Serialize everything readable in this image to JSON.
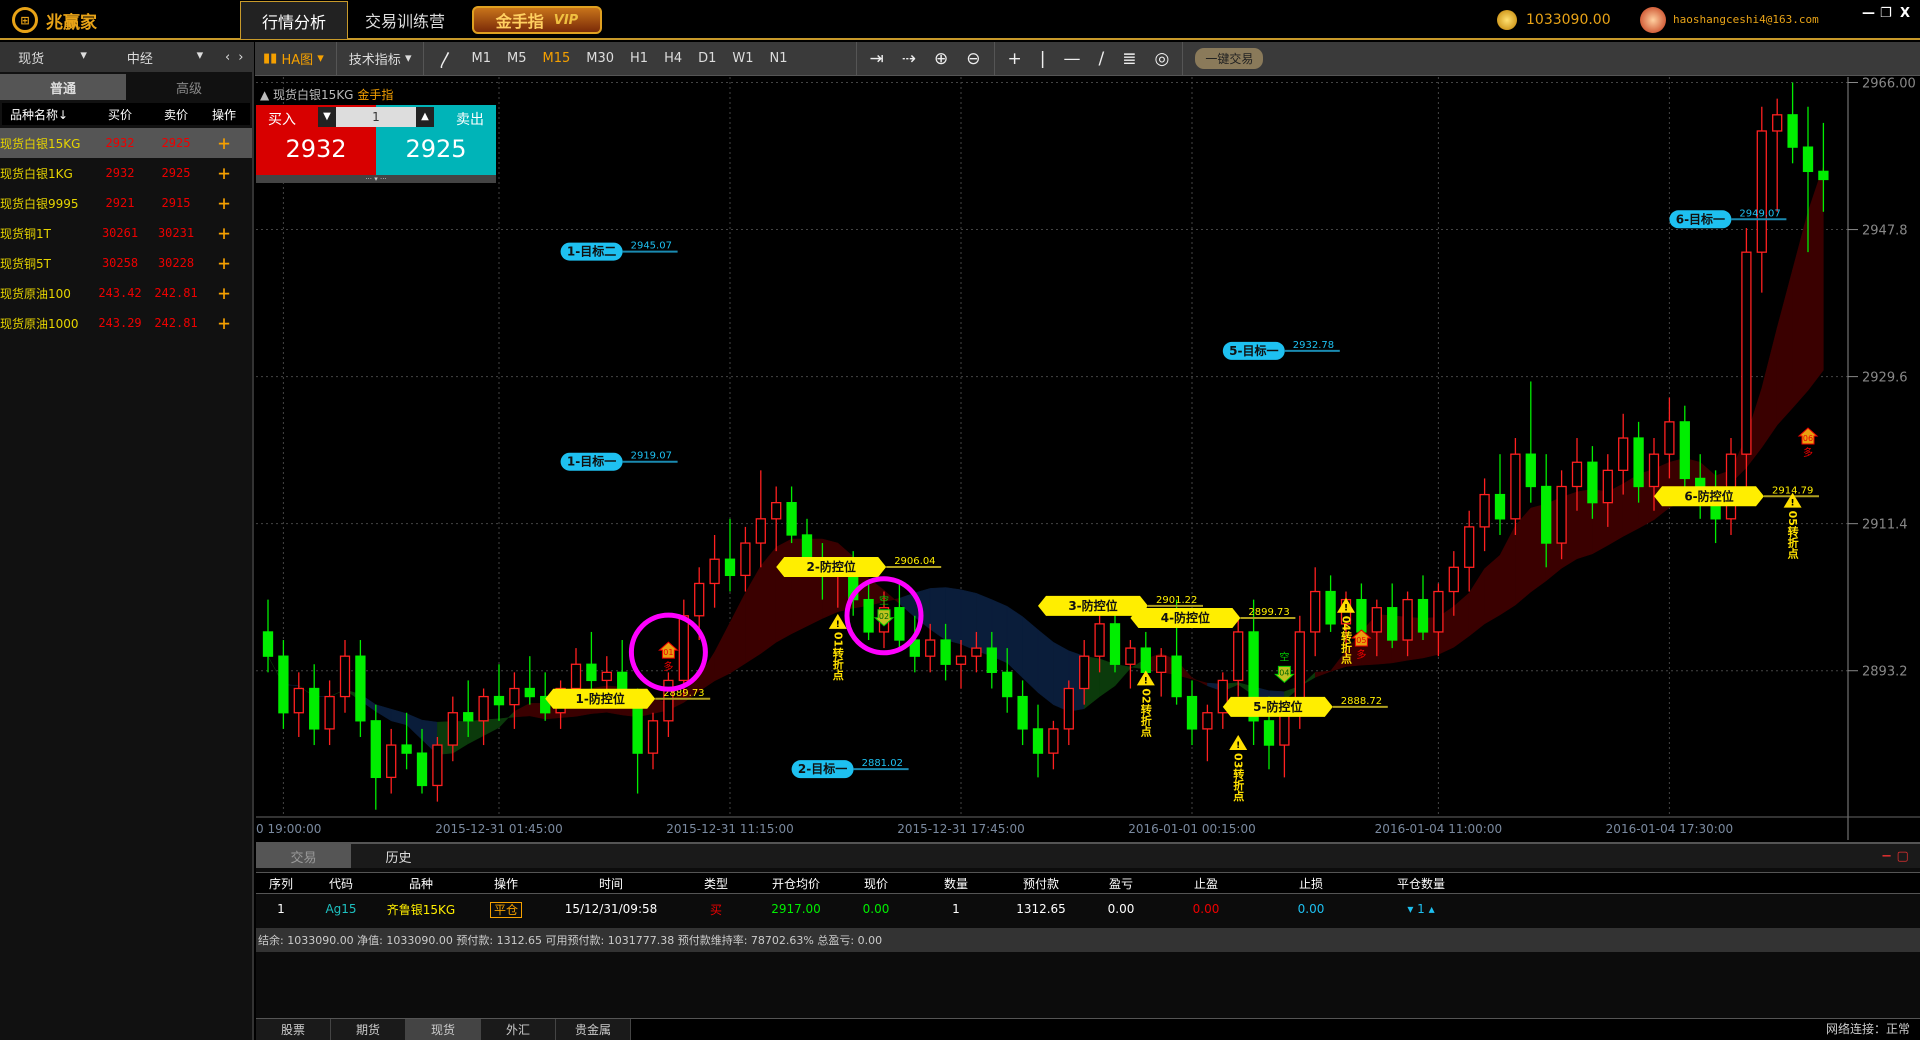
{
  "app": {
    "logo": "兆赢家",
    "tabs": [
      "行情分析",
      "交易训练营"
    ],
    "vip_badge": "金手指",
    "vip_tag": "VIP",
    "balance": "1033090.00",
    "email": "haoshangceshi4@163.com",
    "window_controls": [
      "—",
      "❐",
      "X"
    ]
  },
  "toolbar": {
    "chart_type": "HA图",
    "indicators": "技术指标",
    "periods": [
      "M1",
      "M5",
      "M15",
      "M30",
      "H1",
      "H4",
      "D1",
      "W1",
      "N1"
    ],
    "active_period": "M15",
    "icons": [
      "line-icon",
      "fit-right-icon",
      "move-right-icon",
      "zoom-in-icon",
      "zoom-out-icon",
      "crosshair-icon",
      "vertical-line-icon",
      "horizontal-line-icon",
      "trend-line-icon",
      "fibonacci-icon",
      "ellipse-icon"
    ],
    "one_click": "一键交易"
  },
  "sidebar": {
    "market": "现货",
    "exchange": "中经",
    "subtabs": [
      "普通",
      "高级"
    ],
    "headers": [
      "品种名称↓",
      "买价",
      "卖价",
      "操作"
    ],
    "rows": [
      {
        "name": "现货白银15KG",
        "buy": "2932",
        "sell": "2925"
      },
      {
        "name": "现货白银1KG",
        "buy": "2932",
        "sell": "2925"
      },
      {
        "name": "现货白银9995",
        "buy": "2921",
        "sell": "2915"
      },
      {
        "name": "现货铜1T",
        "buy": "30261",
        "sell": "30231"
      },
      {
        "name": "现货铜5T",
        "buy": "30258",
        "sell": "30228"
      },
      {
        "name": "现货原油100",
        "buy": "243.42",
        "sell": "242.81"
      },
      {
        "name": "现货原油1000",
        "buy": "243.29",
        "sell": "242.81"
      }
    ]
  },
  "order_panel": {
    "symbol": "现货白银15KG",
    "tag": "金手指",
    "buy_label": "买入",
    "sell_label": "卖出",
    "quantity": "1",
    "buy_price": "2932",
    "sell_price": "2925"
  },
  "colors": {
    "up": "#ff2020",
    "down": "#00ee00",
    "accent": "#f5a000",
    "target": "#1ec0f0",
    "defense": "#ffee00",
    "highlight": "#ff00ff"
  },
  "chart_data": {
    "type": "candlestick",
    "ylim": [
      2875,
      2966
    ],
    "y_ticks": [
      "2966.00",
      "2947.8",
      "2929.6",
      "2911.4",
      "2893.2"
    ],
    "y_tick_values": [
      2966,
      2947.8,
      2929.6,
      2911.4,
      2893.2
    ],
    "x_ticks": [
      "0 19:00:00",
      "2015-12-31 01:45:00",
      "2015-12-31 11:15:00",
      "2015-12-31 17:45:00",
      "2016-01-01 00:15:00",
      "2016-01-04 11:00:00",
      "2016-01-04 17:30:00"
    ],
    "x_tick_index": [
      1,
      15,
      30,
      45,
      60,
      76,
      91
    ],
    "ohlc": [
      [
        2898,
        2902,
        2893,
        2895
      ],
      [
        2895,
        2897,
        2886,
        2888
      ],
      [
        2888,
        2893,
        2885,
        2891
      ],
      [
        2891,
        2894,
        2884,
        2886
      ],
      [
        2886,
        2892,
        2884,
        2890
      ],
      [
        2890,
        2897,
        2888,
        2895
      ],
      [
        2895,
        2897,
        2885,
        2887
      ],
      [
        2887,
        2889,
        2876,
        2880
      ],
      [
        2880,
        2886,
        2878,
        2884
      ],
      [
        2884,
        2888,
        2881,
        2883
      ],
      [
        2883,
        2886,
        2878,
        2879
      ],
      [
        2879,
        2885,
        2877,
        2884
      ],
      [
        2884,
        2890,
        2882,
        2888
      ],
      [
        2888,
        2892,
        2885,
        2887
      ],
      [
        2887,
        2891,
        2884,
        2890
      ],
      [
        2890,
        2894,
        2887,
        2889
      ],
      [
        2889,
        2893,
        2886,
        2891
      ],
      [
        2891,
        2895,
        2889,
        2890
      ],
      [
        2890,
        2893,
        2887,
        2888
      ],
      [
        2888,
        2892,
        2886,
        2891
      ],
      [
        2891,
        2896,
        2889,
        2894
      ],
      [
        2894,
        2898,
        2890,
        2892
      ],
      [
        2892,
        2895,
        2889,
        2893
      ],
      [
        2893,
        2897,
        2890,
        2889
      ],
      [
        2889,
        2891,
        2878,
        2883
      ],
      [
        2883,
        2888,
        2881,
        2887
      ],
      [
        2887,
        2893,
        2885,
        2892
      ],
      [
        2892,
        2902,
        2890,
        2900
      ],
      [
        2900,
        2906,
        2897,
        2904
      ],
      [
        2904,
        2910,
        2901,
        2907
      ],
      [
        2907,
        2912,
        2903,
        2905
      ],
      [
        2905,
        2911,
        2903,
        2909
      ],
      [
        2909,
        2918,
        2906,
        2912
      ],
      [
        2912,
        2916,
        2908,
        2914
      ],
      [
        2914,
        2916,
        2909,
        2910
      ],
      [
        2910,
        2912,
        2905,
        2907
      ],
      [
        2907,
        2909,
        2902,
        2905
      ],
      [
        2905,
        2907,
        2901,
        2906
      ],
      [
        2906,
        2908,
        2900,
        2902
      ],
      [
        2902,
        2904,
        2897,
        2898
      ],
      [
        2898,
        2903,
        2896,
        2901
      ],
      [
        2901,
        2904,
        2896,
        2897
      ],
      [
        2897,
        2900,
        2893,
        2895
      ],
      [
        2895,
        2899,
        2893,
        2897
      ],
      [
        2897,
        2899,
        2892,
        2894
      ],
      [
        2894,
        2897,
        2891,
        2895
      ],
      [
        2895,
        2898,
        2893,
        2896
      ],
      [
        2896,
        2898,
        2891,
        2893
      ],
      [
        2893,
        2896,
        2888,
        2890
      ],
      [
        2890,
        2892,
        2884,
        2886
      ],
      [
        2886,
        2889,
        2880,
        2883
      ],
      [
        2883,
        2887,
        2881,
        2886
      ],
      [
        2886,
        2892,
        2884,
        2891
      ],
      [
        2891,
        2897,
        2889,
        2895
      ],
      [
        2895,
        2901,
        2893,
        2899
      ],
      [
        2899,
        2901,
        2893,
        2894
      ],
      [
        2894,
        2897,
        2891,
        2896
      ],
      [
        2896,
        2898,
        2892,
        2893
      ],
      [
        2893,
        2896,
        2890,
        2895
      ],
      [
        2895,
        2902,
        2889,
        2890
      ],
      [
        2890,
        2892,
        2884,
        2886
      ],
      [
        2886,
        2889,
        2882,
        2888
      ],
      [
        2888,
        2893,
        2886,
        2892
      ],
      [
        2892,
        2900,
        2890,
        2898
      ],
      [
        2898,
        2902,
        2884,
        2887
      ],
      [
        2887,
        2890,
        2881,
        2884
      ],
      [
        2884,
        2889,
        2880,
        2888
      ],
      [
        2888,
        2900,
        2886,
        2898
      ],
      [
        2898,
        2906,
        2895,
        2903
      ],
      [
        2903,
        2905,
        2898,
        2899
      ],
      [
        2899,
        2903,
        2895,
        2902
      ],
      [
        2902,
        2904,
        2897,
        2898
      ],
      [
        2898,
        2902,
        2895,
        2901
      ],
      [
        2901,
        2904,
        2896,
        2897
      ],
      [
        2897,
        2903,
        2895,
        2902
      ],
      [
        2902,
        2905,
        2897,
        2898
      ],
      [
        2898,
        2904,
        2895,
        2903
      ],
      [
        2903,
        2908,
        2900,
        2906
      ],
      [
        2906,
        2913,
        2903,
        2911
      ],
      [
        2911,
        2917,
        2908,
        2915
      ],
      [
        2915,
        2920,
        2910,
        2912
      ],
      [
        2912,
        2922,
        2910,
        2920
      ],
      [
        2920,
        2929,
        2914,
        2916
      ],
      [
        2916,
        2920,
        2906,
        2909
      ],
      [
        2909,
        2918,
        2907,
        2916
      ],
      [
        2916,
        2922,
        2913,
        2919
      ],
      [
        2919,
        2921,
        2912,
        2914
      ],
      [
        2914,
        2920,
        2911,
        2918
      ],
      [
        2918,
        2925,
        2915,
        2922
      ],
      [
        2922,
        2924,
        2914,
        2916
      ],
      [
        2916,
        2922,
        2913,
        2920
      ],
      [
        2920,
        2927,
        2917,
        2924
      ],
      [
        2924,
        2926,
        2915,
        2917
      ],
      [
        2917,
        2920,
        2912,
        2915
      ],
      [
        2915,
        2918,
        2909,
        2912
      ],
      [
        2912,
        2922,
        2910,
        2920
      ],
      [
        2920,
        2948,
        2914,
        2945
      ],
      [
        2945,
        2963,
        2940,
        2960
      ],
      [
        2960,
        2964,
        2950,
        2962
      ],
      [
        2962,
        2966,
        2956,
        2958
      ],
      [
        2958,
        2963,
        2945,
        2955
      ],
      [
        2955,
        2961,
        2950,
        2954
      ]
    ],
    "levels": [
      {
        "label": "1-目标二",
        "price": 2945.07,
        "value": "2945.07",
        "index": 19,
        "kind": "target"
      },
      {
        "label": "1-目标一",
        "price": 2919.07,
        "value": "2919.07",
        "index": 19,
        "kind": "target"
      },
      {
        "label": "1-防控位",
        "price": 2889.73,
        "value": "2889.73",
        "index": 18,
        "kind": "defense"
      },
      {
        "label": "2-防控位",
        "price": 2906.04,
        "value": "2906.04",
        "index": 33,
        "kind": "defense"
      },
      {
        "label": "2-目标一",
        "price": 2881.02,
        "value": "2881.02",
        "index": 34,
        "kind": "target"
      },
      {
        "label": "3-防控位",
        "price": 2901.22,
        "value": "2901.22",
        "index": 50,
        "kind": "defense"
      },
      {
        "label": "4-防控位",
        "price": 2899.73,
        "value": "2899.73",
        "index": 56,
        "kind": "defense"
      },
      {
        "label": "5-目标一",
        "price": 2932.78,
        "value": "2932.78",
        "index": 62,
        "kind": "target"
      },
      {
        "label": "5-防控位",
        "price": 2888.72,
        "value": "2888.72",
        "index": 62,
        "kind": "defense"
      },
      {
        "label": "6-目标一",
        "price": 2949.07,
        "value": "2949.07",
        "index": 91,
        "kind": "target"
      },
      {
        "label": "6-防控位",
        "price": 2914.79,
        "value": "2914.79",
        "index": 90,
        "kind": "defense"
      }
    ],
    "signals": [
      {
        "id": "01",
        "side": "多",
        "dir": "buy",
        "index": 26,
        "price": 2895.5,
        "highlighted": true
      },
      {
        "id": "02",
        "side": "空",
        "dir": "sell",
        "index": 40,
        "price": 2900,
        "highlighted": true
      },
      {
        "id": "04",
        "side": "空",
        "dir": "sell",
        "index": 66,
        "price": 2893,
        "highlighted": false
      },
      {
        "id": "05",
        "side": "多",
        "dir": "buy",
        "index": 71,
        "price": 2897,
        "highlighted": false
      },
      {
        "id": "06",
        "side": "多",
        "dir": "buy",
        "index": 100,
        "price": 2922,
        "highlighted": false
      }
    ],
    "turning_points": [
      {
        "label": "01转折点",
        "index": 37,
        "price": 2899
      },
      {
        "label": "02转折点",
        "index": 57,
        "price": 2892
      },
      {
        "label": "03转折点",
        "index": 63,
        "price": 2884
      },
      {
        "label": "04转折点",
        "index": 70,
        "price": 2901
      },
      {
        "label": "05转折点",
        "index": 99,
        "price": 2914
      }
    ]
  },
  "bottom": {
    "tabs": [
      "交易",
      "历史"
    ],
    "columns": [
      "序列",
      "代码",
      "品种",
      "操作",
      "时间",
      "类型",
      "开仓均价",
      "现价",
      "数量",
      "预付款",
      "盈亏",
      "止盈",
      "止损",
      "平仓数量"
    ],
    "rows": [
      {
        "seq": "1",
        "code": "Ag15",
        "name": "齐鲁银15KG",
        "action": "平仓",
        "time": "15/12/31/09:58",
        "type": "买",
        "open": "2917.00",
        "current": "0.00",
        "qty": "1",
        "deposit": "1312.65",
        "pnl": "0.00",
        "tp": "0.00",
        "sl": "0.00",
        "close_qty": "1"
      }
    ],
    "summary": "结余: 1033090.00   净值: 1033090.00   预付款: 1312.65   可用预付款: 1031777.38   预付款维持率: 78702.63% 总盈亏: 0.00",
    "footer_tabs": [
      "股票",
      "期货",
      "现货",
      "外汇",
      "贵金属"
    ],
    "active_footer": "现货",
    "network": "网络连接：正常"
  }
}
